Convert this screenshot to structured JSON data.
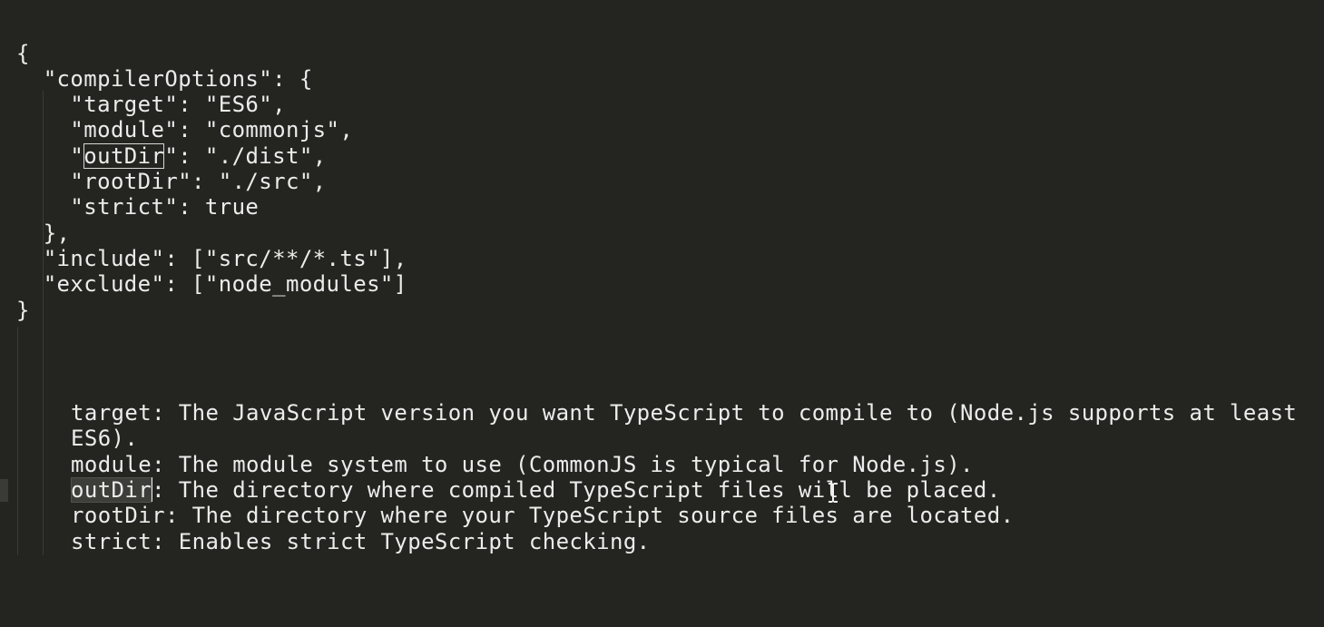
{
  "json_lines": {
    "open_brace": "{",
    "compiler_options_key": "  \"compilerOptions\": {",
    "target": "    \"target\": \"ES6\",",
    "module": "    \"module\": \"commonjs\",",
    "outdir_prefix": "    \"",
    "outdir_word": "outDir",
    "outdir_suffix": "\": \"./dist\",",
    "rootdir": "    \"rootDir\": \"./src\",",
    "strict": "    \"strict\": true",
    "close_options": "  },",
    "include": "  \"include\": [\"src/**/*.ts\"],",
    "exclude": "  \"exclude\": [\"node_modules\"]",
    "close_brace": "}"
  },
  "notes": {
    "target_line1": "target: The JavaScript version you want TypeScript to compile to (Node.js supports at least",
    "target_line2": "ES6).",
    "module": "module: The module system to use (CommonJS is typical for Node.js).",
    "outdir_word": "outDir",
    "outdir_rest": ": The directory where compiled TypeScript files will be placed.",
    "rootdir": "rootDir: The directory where your TypeScript source files are located.",
    "strict": "strict: Enables strict TypeScript checking."
  },
  "colors": {
    "background": "#242421",
    "text": "#ececec"
  },
  "icons": {
    "cursor": "text-ibeam-cursor"
  }
}
